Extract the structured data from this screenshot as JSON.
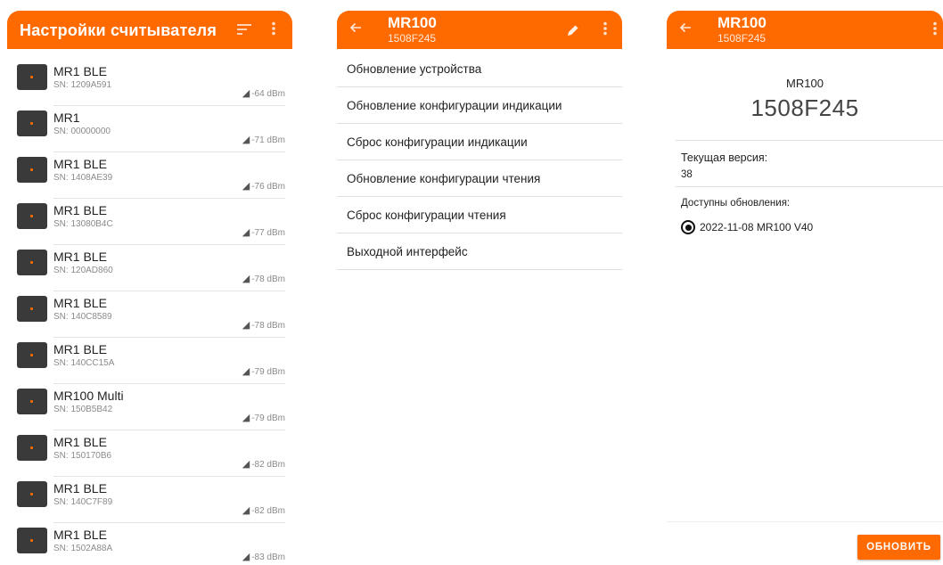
{
  "colors": {
    "accent": "#ff6a00"
  },
  "panel1": {
    "title": "Настройки считывателя",
    "sort_icon": "sort-icon",
    "more_icon": "more-vert-icon",
    "readers": [
      {
        "name": "MR1 BLE",
        "sn": "SN: 1209A591",
        "rssi": "-64 dBm"
      },
      {
        "name": "MR1",
        "sn": "SN: 00000000",
        "rssi": "-71 dBm"
      },
      {
        "name": "MR1 BLE",
        "sn": "SN: 1408AE39",
        "rssi": "-76 dBm"
      },
      {
        "name": "MR1 BLE",
        "sn": "SN: 13080B4C",
        "rssi": "-77 dBm"
      },
      {
        "name": "MR1 BLE",
        "sn": "SN: 120AD860",
        "rssi": "-78 dBm"
      },
      {
        "name": "MR1 BLE",
        "sn": "SN: 140C8589",
        "rssi": "-78 dBm"
      },
      {
        "name": "MR1 BLE",
        "sn": "SN: 140CC15A",
        "rssi": "-79 dBm"
      },
      {
        "name": "MR100 Multi",
        "sn": "SN: 150B5B42",
        "rssi": "-79 dBm"
      },
      {
        "name": "MR1 BLE",
        "sn": "SN: 150170B6",
        "rssi": "-82 dBm"
      },
      {
        "name": "MR1 BLE",
        "sn": "SN: 140C7F89",
        "rssi": "-82 dBm"
      },
      {
        "name": "MR1 BLE",
        "sn": "SN: 1502A88A",
        "rssi": "-83 dBm"
      }
    ]
  },
  "panel2": {
    "title": "MR100",
    "subtitle": "1508F245",
    "back_icon": "arrow-back-icon",
    "edit_icon": "pencil-icon",
    "more_icon": "more-vert-icon",
    "menu": [
      "Обновление устройства",
      "Обновление конфигурации индикации",
      "Сброс конфигурации индикации",
      "Обновление конфигурации чтения",
      "Сброс конфигурации чтения",
      "Выходной интерфейс"
    ]
  },
  "panel3": {
    "title": "MR100",
    "subtitle": "1508F245",
    "back_icon": "arrow-back-icon",
    "more_icon": "more-vert-icon",
    "model": "MR100",
    "serial": "1508F245",
    "current_version_label": "Текущая версия:",
    "current_version": "38",
    "updates_label": "Доступны обновления:",
    "updates": [
      "2022-11-08 MR100 V40"
    ],
    "update_button": "ОБНОВИТЬ"
  }
}
